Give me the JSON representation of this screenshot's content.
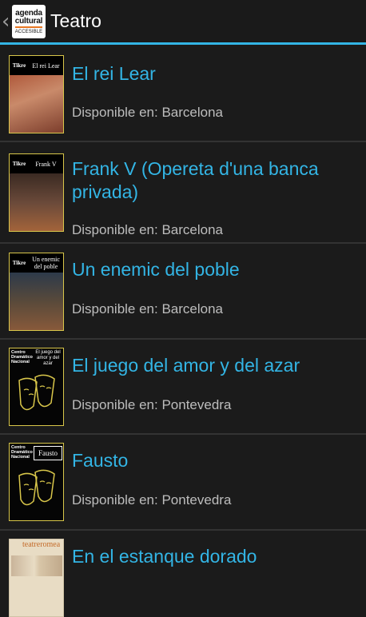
{
  "actionbar": {
    "title": "Teatro",
    "logo": {
      "line1": "agenda",
      "line2": "cultural",
      "line3": "ACCESIBLE"
    },
    "accent": "#33b5e5"
  },
  "items": [
    {
      "title": "El rei Lear",
      "availability": "Disponible en: Barcelona",
      "thumb": {
        "brand": "Tikre",
        "title": "El rei Lear"
      }
    },
    {
      "title": "Frank V (Opereta d'una banca privada)",
      "availability": "Disponible en: Barcelona",
      "thumb": {
        "brand": "Tikre",
        "title": "Frank V"
      }
    },
    {
      "title": "Un enemic del poble",
      "availability": "Disponible en: Barcelona",
      "thumb": {
        "brand": "Tikre",
        "title": "Un enemic del poble"
      }
    },
    {
      "title": "El juego del amor y del azar",
      "availability": "Disponible en: Pontevedra",
      "thumb": {
        "brand": "Centro Dramático Nacional",
        "title": "El juego del amor y del azar"
      }
    },
    {
      "title": "Fausto",
      "availability": "Disponible en: Pontevedra",
      "thumb": {
        "brand": "Centro Dramático Nacional",
        "title": "Fausto"
      }
    },
    {
      "title": "En el estanque dorado",
      "availability": "",
      "thumb": {
        "brand": "teatreromea",
        "title": ""
      }
    }
  ]
}
